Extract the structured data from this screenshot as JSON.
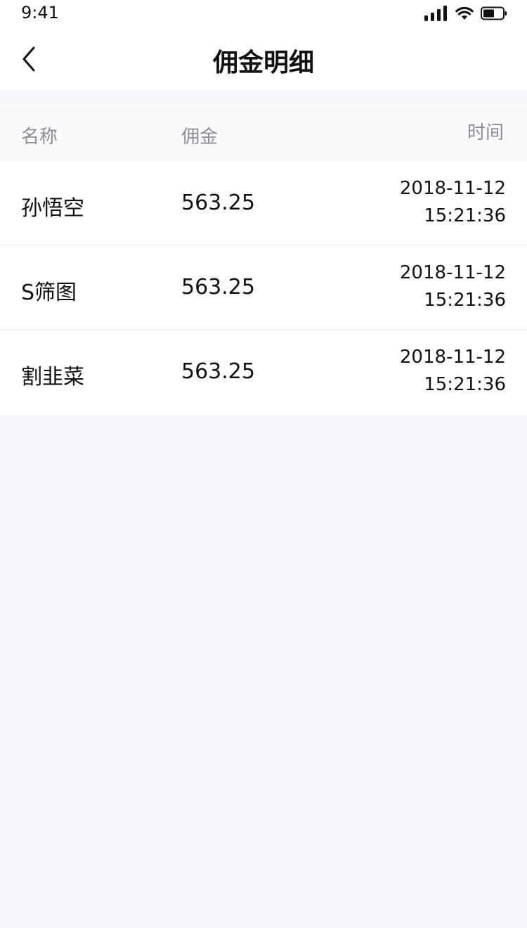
{
  "status_bar": {
    "time": "9:41",
    "icons": [
      "signal-icon",
      "wifi-icon",
      "battery-icon"
    ]
  },
  "nav": {
    "title": "佣金明细",
    "back_icon": "chevron-left-icon"
  },
  "table": {
    "headers": {
      "name": "名称",
      "amount": "佣金",
      "time": "时间"
    },
    "rows": [
      {
        "name": "孙悟空",
        "amount": "563.25",
        "date": "2018-11-12",
        "clock": "15:21:36"
      },
      {
        "name": "S筛图",
        "amount": "563.25",
        "date": "2018-11-12",
        "clock": "15:21:36"
      },
      {
        "name": "割韭菜",
        "amount": "563.25",
        "date": "2018-11-12",
        "clock": "15:21:36"
      }
    ]
  },
  "colors": {
    "background": "#f5f5fa",
    "header_text": "#8a8d99",
    "text": "#111111"
  }
}
